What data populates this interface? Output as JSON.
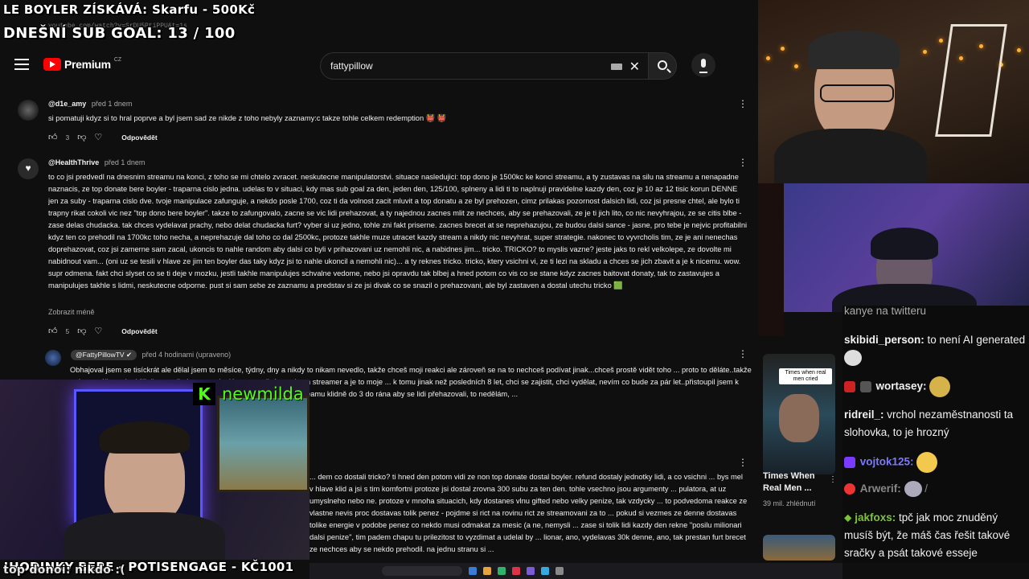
{
  "overlay": {
    "line1": "LE BOYLER ZÍSKÁVÁ: Skarfu - 500Kč",
    "line2": "DNEŠNÍ SUB GOAL: 13 / 100",
    "bottom1": "!HODINKY BERE - POTISENGAGE - KČ1001",
    "bottom2": "top donoi: nikdo :("
  },
  "browser": {
    "url": "youtube.com/watch?v=SrDU5PtiPPU&t=1s"
  },
  "youtube": {
    "logo_text": "Premium",
    "logo_region": "CZ",
    "search_value": "fattypillow",
    "comments": [
      {
        "author": "@d1e_amy",
        "time": "před 1 dnem",
        "text": "si pomatuji kdyz si to hral poprve a byl jsem sad ze nikde z toho nebyly zaznamy:c takze tohle celkem redemption 👹 👹",
        "likes": "3",
        "reply_label": "Odpovědět"
      },
      {
        "author": "@HealthThrive",
        "time": "před 1 dnem",
        "text": "to co jsi predvedl na dnesnim streamu na konci, z toho se mi chtelo zvracet. neskutecne manipulatorstvi. situace nasledujici: top dono je 1500kc ke konci streamu, a ty zustavas na silu na streamu a nenapadne naznacis, ze top donate bere boyler - traparna cislo jedna. udelas to v situaci, kdy mas sub goal za den, jeden den, 125/100, splneny a lidi ti to naplnuji pravidelne kazdy den, coz je 10 az 12 tisic korun DENNE jen za suby - traparna cislo dve. tvoje manipulace zafunguje, a nekdo posle 1700, coz ti da volnost zacit mluvit a top donatu a ze byl prehozen, cimz prilakas pozornost dalsich lidi, coz jsi presne chtel, ale bylo ti trapny rikat cokoli vic nez \"top dono bere boyler\". takze to zafungovalo, zacne se vic lidi prehazovat, a ty najednou zacnes mlit ze nechces, aby se prehazovali, ze je ti jich lito, co nic nevyhrajou, ze se citis blbe - zase delas chudacka. tak chces vydelavat prachy, nebo delat chudacka furt? vyber si uz jedno, tohle zni fakt priserne. zacnes brecet at se neprehazujou, ze budou dalsi sance - jasne, pro tebe je nejvic profitabilni kdyz ten co prehodil na 1700kc toho necha, a neprehazuje dal toho co dal 2500kc, protoze takhle muze utracet kazdy stream a nikdy nic nevyhrat, super strategie. nakonec to vyvrcholis tim, ze je ani nenechas doprehazovat, coz jsi zamerne sam zacal, ukoncis to nahle random aby dalsi co byli v prihazovani uz nemohli nic, a nabidnes jim... tricko. TRICKO? to myslis vazne? jeste jaks to rekl velkolepe, ze dovolte mi nabidnout vam... (oni uz se tesili v hlave ze jim ten boyler das taky kdyz jsi to nahle ukoncil a nemohli nic)... a ty reknes tricko. tricko, ktery vsichni vi, ze ti lezi na skladu a chces se jich zbavit a je k nicemu. wow. supr odmena. fakt chci slyset co se ti deje v mozku, jestli takhle manipulujes schvalne vedome, nebo jsi opravdu tak blbej a hned potom co vis co se stane kdyz zacnes baitovat donaty, tak to zastavujes a manipulujes takhle s lidmi, neskutecne odporne. pust si sam sebe ze zaznamu a predstav si ze jsi divak co se snazil o prehazovani, ale byl zastaven a dostal utechu tricko 🟩",
        "likes": "5",
        "reply_label": "Odpovědět",
        "collapse_label": "Zobrazit méně"
      },
      {
        "author": "@FattyPillowTV",
        "time": "před 4 hodinami (upraveno)",
        "text": "Obhajoval jsem se tisíckrát ale dělal jsem to měsíce, týdny, dny a nikdy to nikam nevedlo, takže chceš moji reakci ale zároveň se na to nechceš podívat jinak...chceš prostě vidět toho ... proto to děláte..takže tady to máš... pokud žiješ v tom že jsem manipulátor, nezměním to, jsem streamer a je to moje ... k tomu jinak než posledních 8 let, chci se zajistit, chci vydělat, nevím co bude za pár let..přistoupil jsem k tomu i jako k ... kluci přehazovali hodinu v kuse, někdo třeba sedí na streamu klidně do 3 do rána aby se lidi přehazovali, to nedělám, ..."
      },
      {
        "text": "... dem co dostali tricko? ti hned den potom vidi ze non top donate dostal boyler. refund dostaly jednotky lidi, a co vsichni ... bys mel v hlave klid a jsi s tim komfortni protoze jsi dostal zrovna 300 subu za ten den. tohle vsechno jsou argumenty ... pulatora, at uz umyslneho nebo ne. protoze v mnoha situacich, kdy dostanes vlnu gifted nebo velky penize, tak vzdycky ... to podvedoma reakce ze vlastne nevis proc dostavas tolik penez - pojdme si rict na rovinu rict ze streamovani za to ... pokud si vezmes ze denne dostavas tolike energie v podobe penez co nekdo musi odmakat za mesic (a ne, nemysli ... zase si tolik lidi kazdy den rekne \"posilu milionari dalsi penize\", tim padem chapu tu prilezitost to vyzdimat a udelal by ... lionar, ano, vydelavas 30k denne, ano, tak prestan furt brecet ze nechces aby se nekdo prehodil. na jednu stranu si ..."
      }
    ]
  },
  "kick": {
    "channel": "newmilda"
  },
  "suggested": {
    "thumb_tag": "Times when real men cried",
    "title": "Times When Real Men ...",
    "views": "39 mil. zhlédnutí"
  },
  "chat": [
    {
      "user": "",
      "text": "kanye na twitteru",
      "color": "#f1f1f1"
    },
    {
      "user": "skibidi_person:",
      "text": " to není AI generated",
      "color": "#f1f1f1"
    },
    {
      "user": "wortasey:",
      "text": "",
      "color": "#f1f1f1"
    },
    {
      "user": "ridreil_:",
      "text": " vrchol nezaměstnanosti ta slohovka, to je hrozný",
      "color": "#f1f1f1"
    },
    {
      "user": "vojtok125:",
      "text": "",
      "color": "#7a7aff"
    },
    {
      "user": "Arwerif:",
      "text": " /",
      "color": "#888888"
    },
    {
      "user": "jakfoxs:",
      "text": " tpč jak moc znuděný musíš být, že máš čas řešit takové sračky a psát takové esseje",
      "color": "#7fc23a"
    }
  ],
  "colors": {
    "kick_green": "#53fc18",
    "youtube_red": "#ff0000"
  }
}
